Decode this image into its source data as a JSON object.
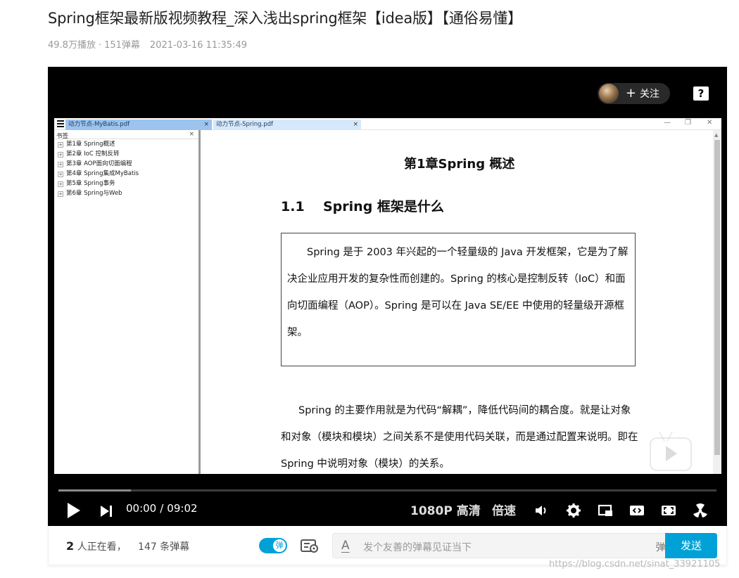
{
  "video": {
    "title": "Spring框架最新版视频教程_深入浅出spring框架【idea版】【通俗易懂】",
    "plays": "49.8万播放",
    "separator": "·",
    "danmaku_count": "151弹幕",
    "date": "2021-03-16 11:35:49"
  },
  "player": {
    "follow_plus": "+",
    "follow_label": "关注",
    "help_label": "?",
    "progress_buffered": 0.11,
    "time_current": "00:00",
    "time_sep": "/",
    "time_total": "09:02",
    "quality": "1080P 高清",
    "speed": "倍速"
  },
  "screen": {
    "tabs": [
      {
        "label": "动力节点-MyBatis.pdf",
        "close": "×"
      },
      {
        "label": "动力节点-Spring.pdf",
        "close": "×"
      }
    ],
    "window_controls": [
      "—",
      "❐",
      "✕"
    ],
    "sidebar": {
      "header": "书签",
      "close": "×",
      "items": [
        {
          "toggle": "+",
          "label": "第1章 Spring概述"
        },
        {
          "toggle": "+",
          "label": "第2章 IoC 控制反转"
        },
        {
          "toggle": "+",
          "label": "第3章 AOP面向切面编程"
        },
        {
          "toggle": "+",
          "label": "第4章 Spring集成MyBatis"
        },
        {
          "toggle": "+",
          "label": "第5章 Spring事务"
        },
        {
          "toggle": "+",
          "label": "第6章 Spring与Web"
        }
      ]
    },
    "document": {
      "chapter": "第1章Spring 概述",
      "section_number": "1.1",
      "section_title": "Spring 框架是什么",
      "box_text": "Spring 是于 2003 年兴起的一个轻量级的 Java 开发框架，它是为了解决企业应用开发的复杂性而创建的。Spring 的核心是控制反转（IoC）和面向切面编程（AOP）。Spring 是可以在 Java SE/EE 中使用的轻量级开源框架。",
      "paragraph": "Spring 的主要作用就是为代码“解耦”，降低代码间的耦合度。就是让对象和对象（模块和模块）之间关系不是使用代码关联，而是通过配置来说明。即在 Spring 中说明对象（模块）的关系。"
    }
  },
  "bottom": {
    "viewers_count": "2",
    "viewers_label": "人正在看，",
    "danmaku_total": "147 条弹幕",
    "toggle_label": "弹",
    "input_font_icon": "A",
    "input_placeholder": "发个友善的弹幕见证当下",
    "etiquette": "弹幕礼仪 〉",
    "send_label": "发送"
  },
  "watermark": "https://blog.csdn.net/sinat_33921105"
}
